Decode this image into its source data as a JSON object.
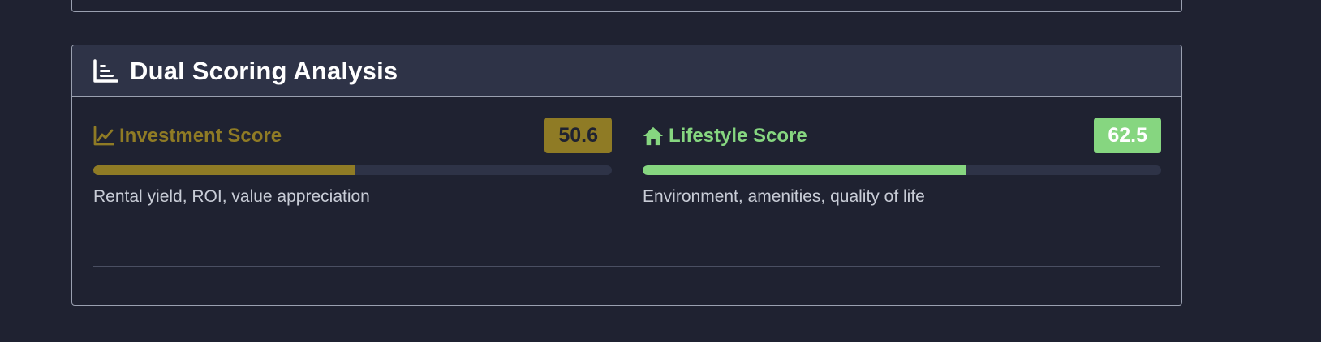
{
  "header": {
    "title": "Dual Scoring Analysis",
    "icon": "bar-chart-icon"
  },
  "scores": {
    "investment": {
      "title": "Investment Score",
      "value": "50.6",
      "fraction": 0.506,
      "description": "Rental yield, ROI, value appreciation",
      "icon": "line-chart-icon",
      "color": "#8f7b25",
      "badge_text_color": "#1f2231"
    },
    "lifestyle": {
      "title": "Lifestyle Score",
      "value": "62.5",
      "fraction": 0.625,
      "description": "Environment, amenities, quality of life",
      "icon": "home-icon",
      "color": "#86d680",
      "badge_text_color": "#ffffff"
    }
  }
}
